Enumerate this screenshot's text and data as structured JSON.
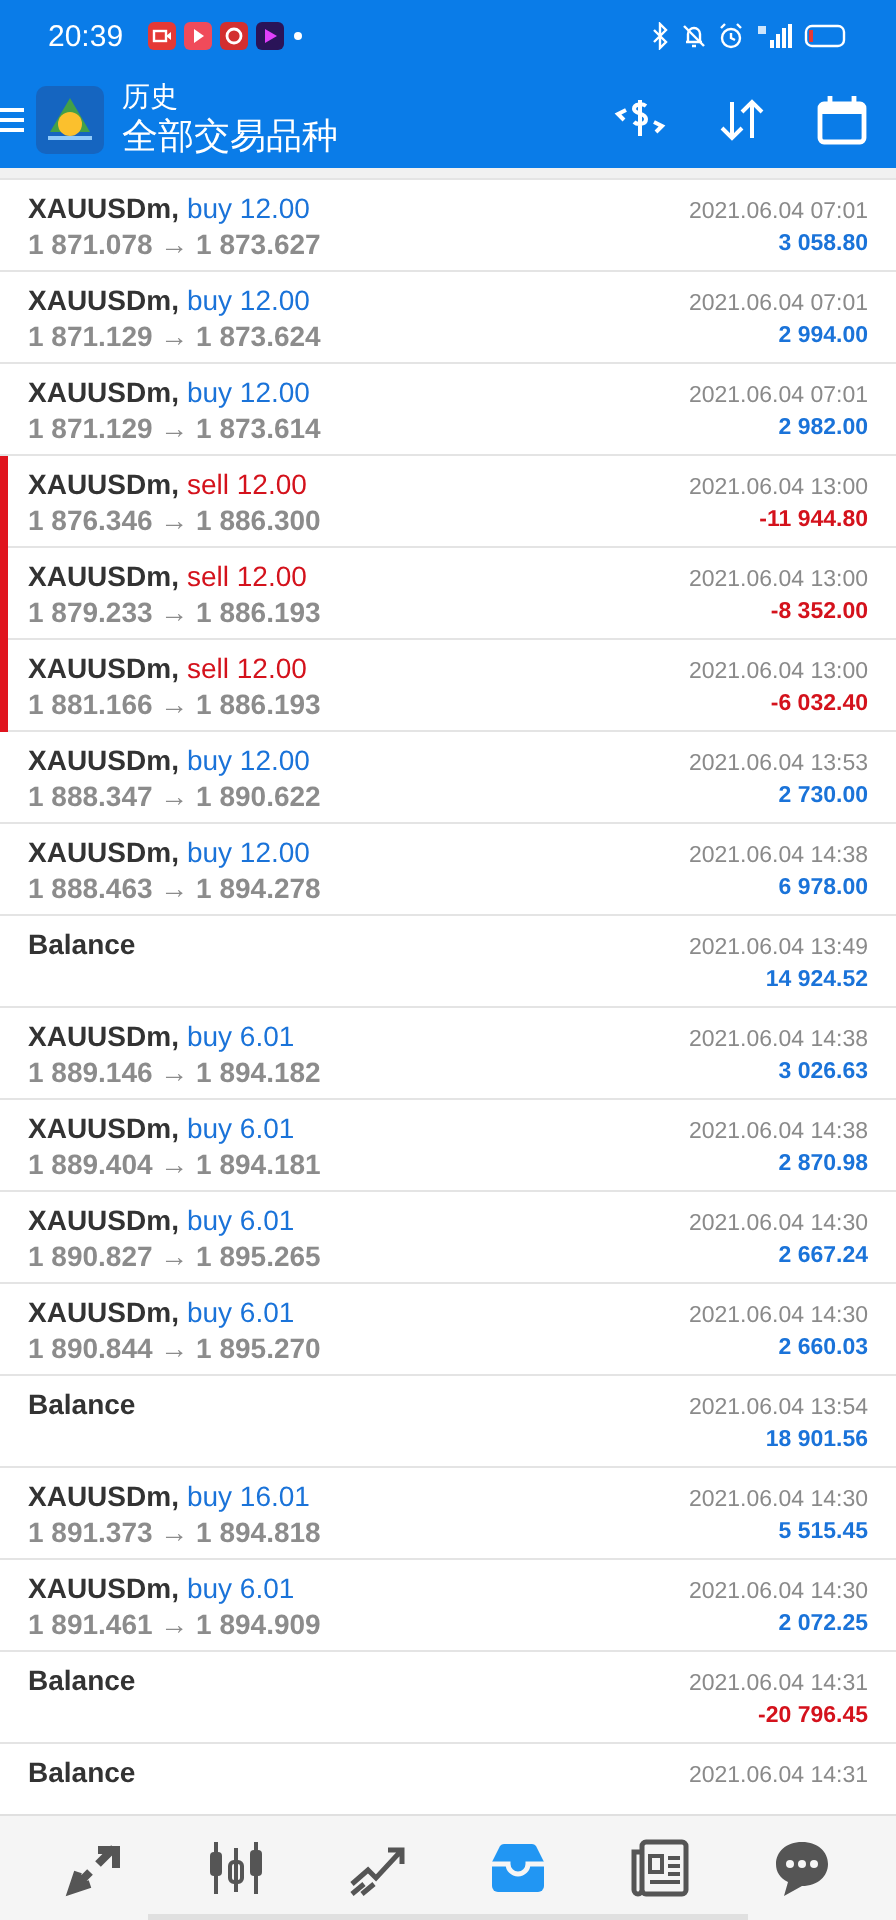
{
  "status_bar": {
    "time": "20:39"
  },
  "header": {
    "title": "历史",
    "subtitle": "全部交易品种"
  },
  "rows": [
    {
      "kind": "buy",
      "symbol": "XAUUSDm,",
      "deal": "buy 12.00",
      "prices": "1 871.078 → 1 873.627",
      "time": "2021.06.04 07:01",
      "amount": "3 058.80",
      "color": "#1a73d9"
    },
    {
      "kind": "buy",
      "symbol": "XAUUSDm,",
      "deal": "buy 12.00",
      "prices": "1 871.129 → 1 873.624",
      "time": "2021.06.04 07:01",
      "amount": "2 994.00",
      "color": "#1a73d9"
    },
    {
      "kind": "buy",
      "symbol": "XAUUSDm,",
      "deal": "buy 12.00",
      "prices": "1 871.129 → 1 873.614",
      "time": "2021.06.04 07:01",
      "amount": "2 982.00",
      "color": "#1a73d9"
    },
    {
      "kind": "sell",
      "symbol": "XAUUSDm,",
      "deal": "sell 12.00",
      "prices": "1 876.346 → 1 886.300",
      "time": "2021.06.04 13:00",
      "amount": "-11 944.80",
      "color": "#d4121c"
    },
    {
      "kind": "sell",
      "symbol": "XAUUSDm,",
      "deal": "sell 12.00",
      "prices": "1 879.233 → 1 886.193",
      "time": "2021.06.04 13:00",
      "amount": "-8 352.00",
      "color": "#d4121c"
    },
    {
      "kind": "sell",
      "symbol": "XAUUSDm,",
      "deal": "sell 12.00",
      "prices": "1 881.166 → 1 886.193",
      "time": "2021.06.04 13:00",
      "amount": "-6 032.40",
      "color": "#d4121c"
    },
    {
      "kind": "buy",
      "symbol": "XAUUSDm,",
      "deal": "buy 12.00",
      "prices": "1 888.347 → 1 890.622",
      "time": "2021.06.04 13:53",
      "amount": "2 730.00",
      "color": "#1a73d9"
    },
    {
      "kind": "buy",
      "symbol": "XAUUSDm,",
      "deal": "buy 12.00",
      "prices": "1 888.463 → 1 894.278",
      "time": "2021.06.04 14:38",
      "amount": "6 978.00",
      "color": "#1a73d9"
    },
    {
      "kind": "balance",
      "symbol": "Balance",
      "time": "2021.06.04 13:49",
      "amount": "14 924.52",
      "color": "#1a73d9"
    },
    {
      "kind": "buy",
      "symbol": "XAUUSDm,",
      "deal": "buy 6.01",
      "prices": "1 889.146 → 1 894.182",
      "time": "2021.06.04 14:38",
      "amount": "3 026.63",
      "color": "#1a73d9"
    },
    {
      "kind": "buy",
      "symbol": "XAUUSDm,",
      "deal": "buy 6.01",
      "prices": "1 889.404 → 1 894.181",
      "time": "2021.06.04 14:38",
      "amount": "2 870.98",
      "color": "#1a73d9"
    },
    {
      "kind": "buy",
      "symbol": "XAUUSDm,",
      "deal": "buy 6.01",
      "prices": "1 890.827 → 1 895.265",
      "time": "2021.06.04 14:30",
      "amount": "2 667.24",
      "color": "#1a73d9"
    },
    {
      "kind": "buy",
      "symbol": "XAUUSDm,",
      "deal": "buy 6.01",
      "prices": "1 890.844 → 1 895.270",
      "time": "2021.06.04 14:30",
      "amount": "2 660.03",
      "color": "#1a73d9"
    },
    {
      "kind": "balance",
      "symbol": "Balance",
      "time": "2021.06.04 13:54",
      "amount": "18 901.56",
      "color": "#1a73d9"
    },
    {
      "kind": "buy",
      "symbol": "XAUUSDm,",
      "deal": "buy 16.01",
      "prices": "1 891.373 → 1 894.818",
      "time": "2021.06.04 14:30",
      "amount": "5 515.45",
      "color": "#1a73d9"
    },
    {
      "kind": "buy",
      "symbol": "XAUUSDm,",
      "deal": "buy 6.01",
      "prices": "1 891.461 → 1 894.909",
      "time": "2021.06.04 14:30",
      "amount": "2 072.25",
      "color": "#1a73d9"
    },
    {
      "kind": "balance",
      "symbol": "Balance",
      "time": "2021.06.04 14:31",
      "amount": "-20 796.45",
      "color": "#d4121c"
    },
    {
      "kind": "balance",
      "symbol": "Balance",
      "time": "2021.06.04 14:31"
    }
  ],
  "nav": [
    {
      "selected": false
    },
    {
      "selected": false
    },
    {
      "selected": false
    },
    {
      "selected": true
    },
    {
      "selected": false
    },
    {
      "selected": false
    }
  ]
}
